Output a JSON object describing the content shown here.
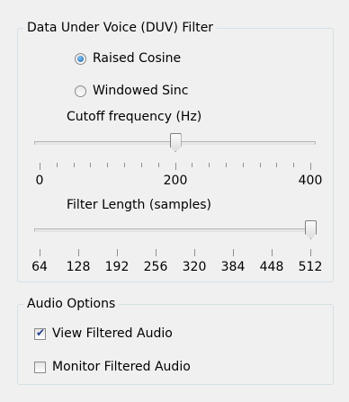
{
  "duv_filter": {
    "title": "Data Under Voice (DUV) Filter",
    "filter_type": {
      "selected": "Raised Cosine",
      "options": [
        "Raised Cosine",
        "Windowed Sinc"
      ]
    },
    "cutoff": {
      "label": "Cutoff frequency (Hz)",
      "value": 200,
      "min": 0,
      "max": 400,
      "tick_labels": [
        "0",
        "200",
        "400"
      ]
    },
    "length": {
      "label": "Filter Length (samples)",
      "value": 512,
      "min": 64,
      "max": 512,
      "tick_labels": [
        "64",
        "128",
        "192",
        "256",
        "320",
        "384",
        "448",
        "512"
      ]
    }
  },
  "audio_options": {
    "title": "Audio Options",
    "view_filtered": {
      "label": "View Filtered Audio",
      "checked": true
    },
    "monitor_filtered": {
      "label": "Monitor Filtered Audio",
      "checked": false
    }
  }
}
